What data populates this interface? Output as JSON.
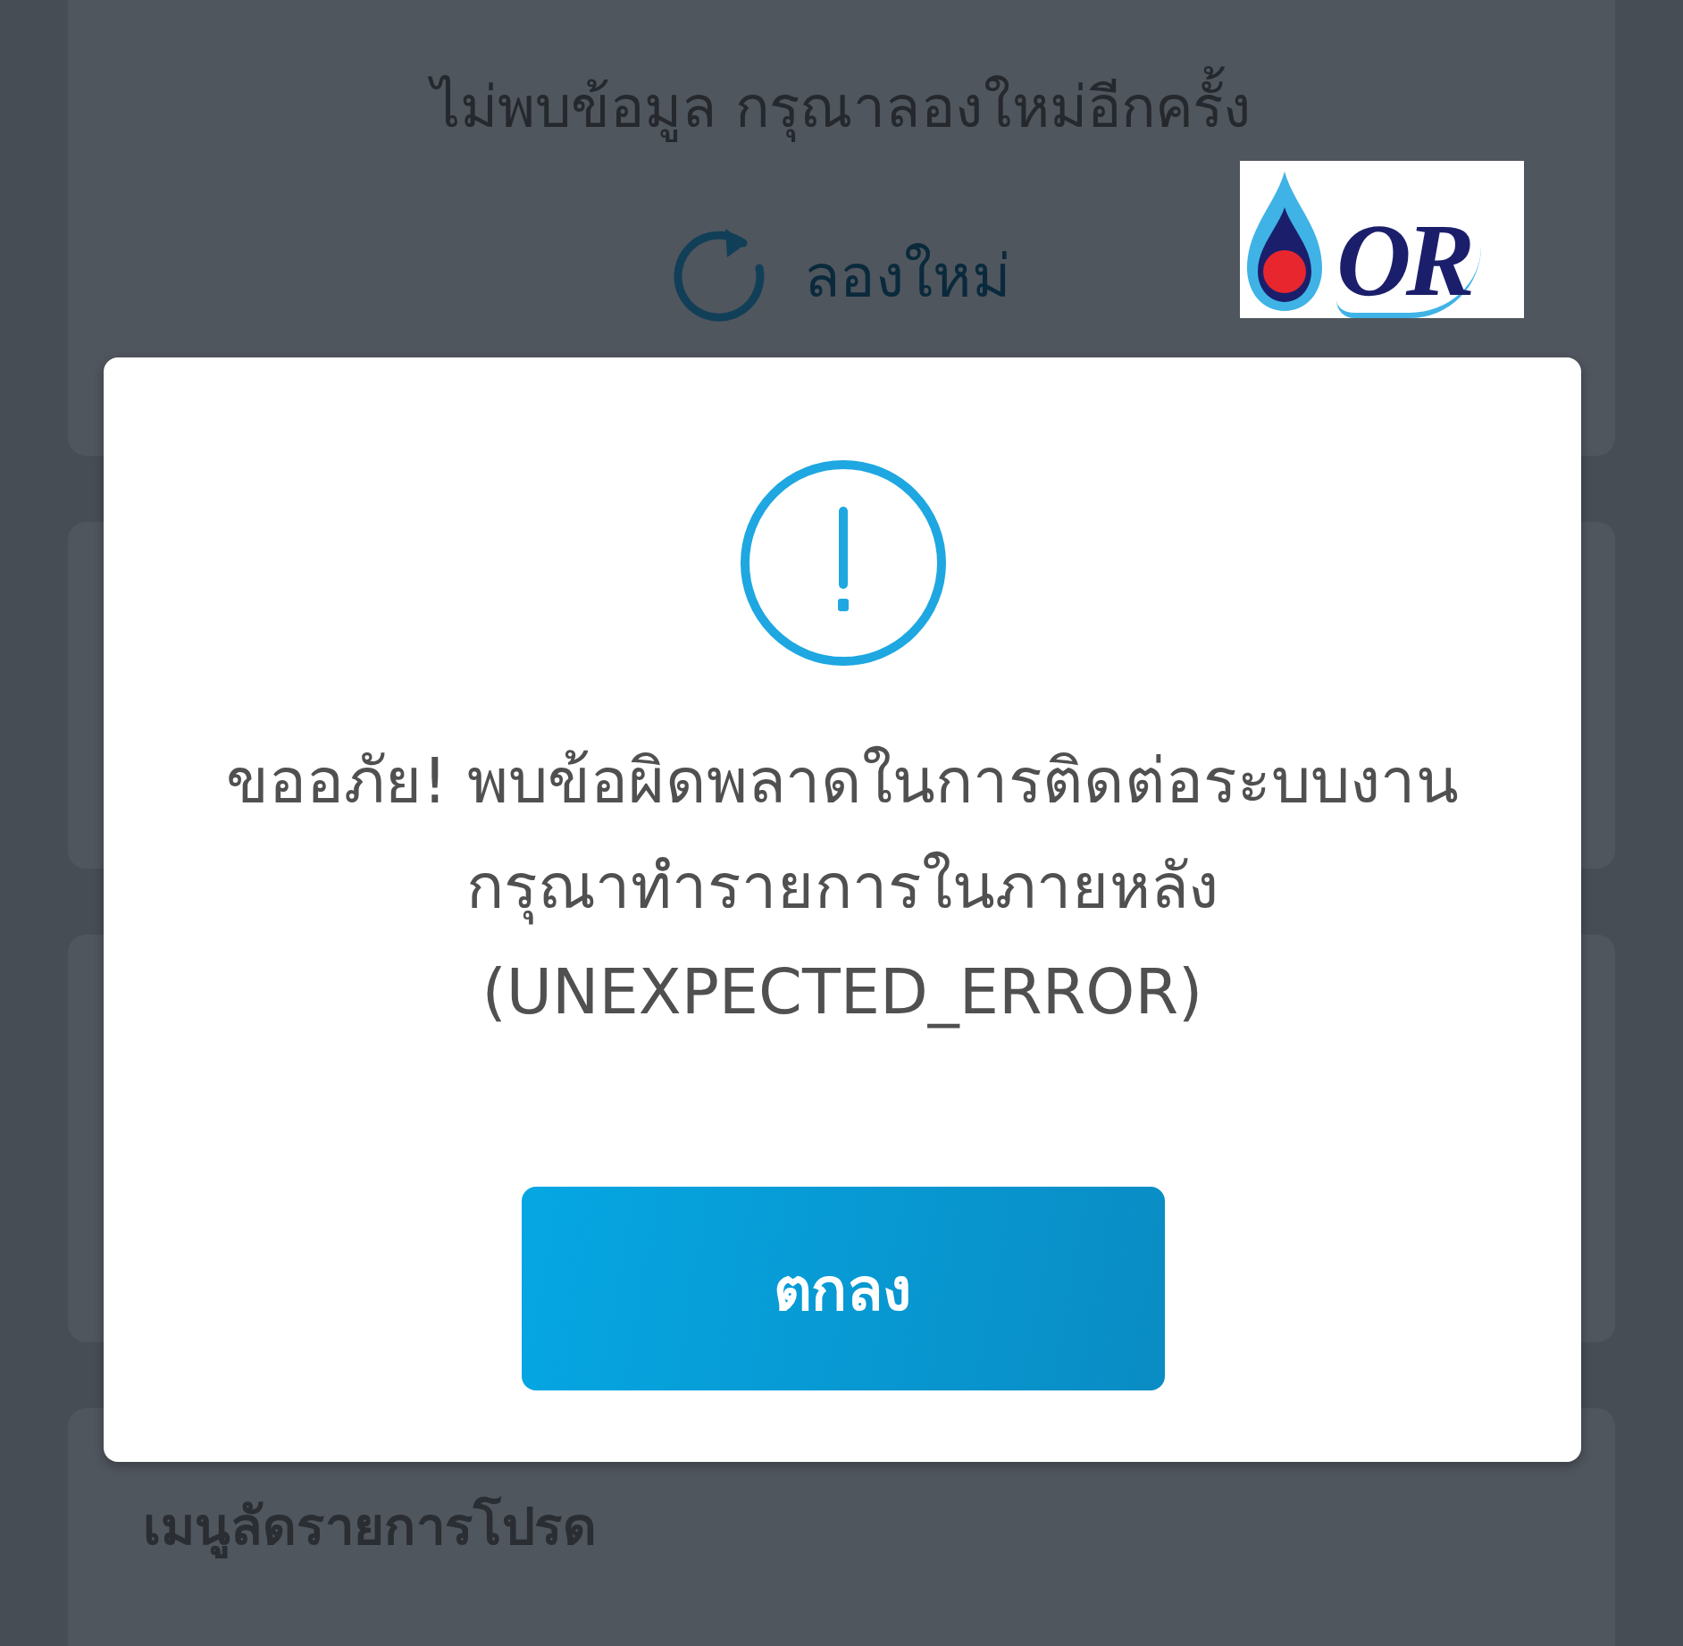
{
  "background": {
    "message": "ไม่พบข้อมูล กรุณาลองใหม่อีกครั้ง",
    "retry_button": "ลองใหม่",
    "favorites_title": "เมนูลัดรายการโปรด"
  },
  "logo": {
    "text": "OR"
  },
  "dialog": {
    "message_lines": [
      "ขออภัย! พบข้อผิดพลาดในการติดต่อระบบงาน",
      "กรุณาทำรายการในภายหลัง",
      "(UNEXPECTED_ERROR)"
    ],
    "button": "ตกลง"
  }
}
